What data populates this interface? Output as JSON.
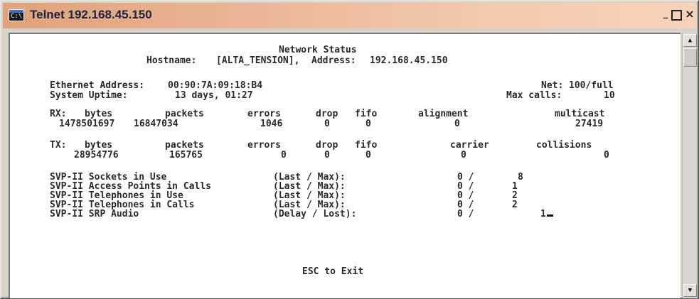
{
  "window": {
    "title": "Telnet 192.168.45.150",
    "minimize_glyph": "_",
    "maximize_glyph": "□",
    "close_glyph": "×",
    "icon": "console-icon",
    "icon_prompt": "C:\\"
  },
  "scrollbar": {
    "up_glyph": "▲",
    "down_glyph": "▼"
  },
  "screen": {
    "heading": "Network Status",
    "hostname_label": "Hostname:",
    "hostname_value": "[ALTA_TENSION],",
    "address_label": "Address:",
    "address_value": "192.168.45.150",
    "ethernet_label": "Ethernet Address:",
    "ethernet_value": "00:90:7A:09:18:B4",
    "net_label": "Net:",
    "net_value": "100/full",
    "uptime_label": "System Uptime:",
    "uptime_value": "13 days, 01:27",
    "maxcalls_label": "Max calls:",
    "maxcalls_value": "10",
    "rx": {
      "label": "RX:",
      "headers": [
        "bytes",
        "packets",
        "errors",
        "drop",
        "fifo",
        "alignment",
        "multicast"
      ],
      "values": [
        "1478501697",
        "16847034",
        "1046",
        "0",
        "0",
        "0",
        "27419"
      ]
    },
    "tx": {
      "label": "TX:",
      "headers": [
        "bytes",
        "packets",
        "errors",
        "drop",
        "fifo",
        "carrier",
        "collisions"
      ],
      "values": [
        "28954776",
        "165765",
        "0",
        "0",
        "0",
        "0",
        "0"
      ]
    },
    "svp_rows": [
      {
        "label": "SVP-II Sockets in Use",
        "kind": "(Last / Max):",
        "first": "0 /",
        "second": "8"
      },
      {
        "label": "SVP-II Access Points in Calls",
        "kind": "(Last / Max):",
        "first": "0 /",
        "second": "1"
      },
      {
        "label": "SVP-II Telephones in Use",
        "kind": "(Last / Max):",
        "first": "0 /",
        "second": "2"
      },
      {
        "label": "SVP-II Telephones in Calls",
        "kind": "(Last / Max):",
        "first": "0 /",
        "second": "2"
      },
      {
        "label": "SVP-II SRP Audio",
        "kind": "(Delay / Lost):",
        "first": "0 /",
        "second": "1"
      }
    ],
    "exit_hint": "ESC to Exit"
  }
}
